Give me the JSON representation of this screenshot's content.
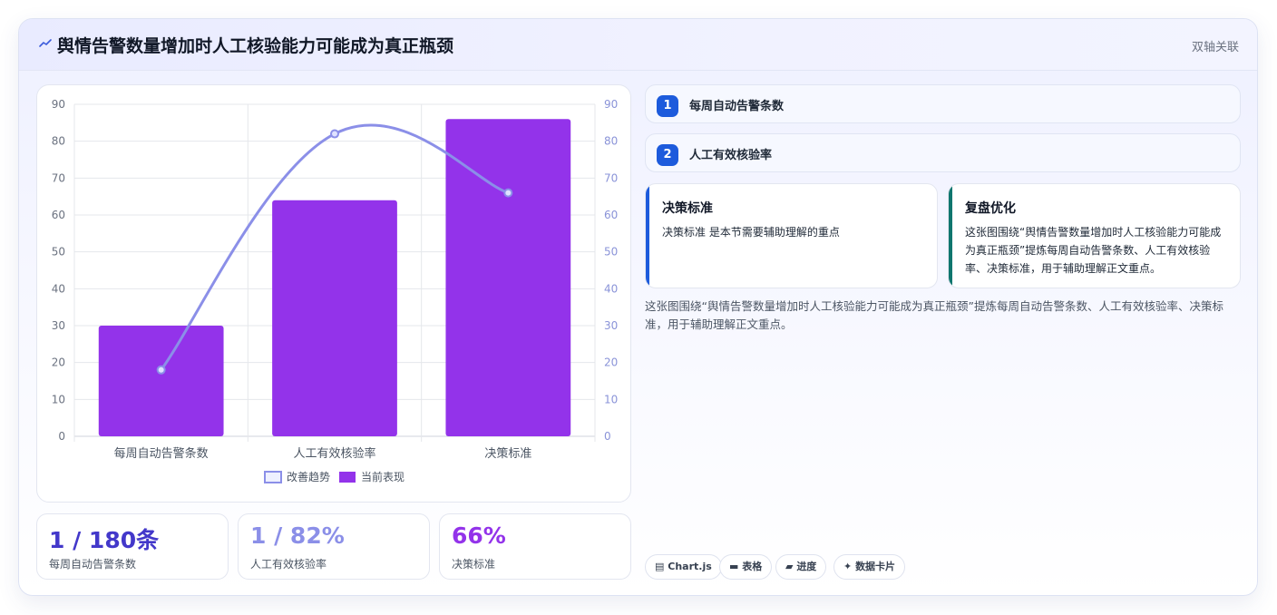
{
  "header": {
    "icon": "trend-line-icon",
    "title": "舆情告警数量增加时人工核验能力可能成为真正瓶颈",
    "tag": "双轴关联"
  },
  "chart_data": {
    "type": "bar",
    "categories": [
      "每周自动告警条数",
      "人工有效核验率",
      "决策标准"
    ],
    "series": [
      {
        "name": "当前表现",
        "kind": "bar",
        "axis": "left",
        "color": "#9333ea",
        "values": [
          30,
          64,
          86
        ]
      },
      {
        "name": "改善趋势",
        "kind": "line",
        "axis": "right",
        "color": "#8b8fe8",
        "values": [
          18,
          82,
          66
        ]
      }
    ],
    "ylim": [
      0,
      90
    ],
    "y2lim": [
      0,
      90
    ],
    "yticks": [
      0,
      10,
      20,
      30,
      40,
      50,
      60,
      70,
      80,
      90
    ],
    "legend_order": [
      "改善趋势",
      "当前表现"
    ],
    "legend_position": "bottom",
    "grid": true
  },
  "stats": [
    {
      "value": "1 / 180条",
      "label": "每周自动告警条数",
      "color": "#4338ca"
    },
    {
      "value": "1 / 82%",
      "label": "人工有效核验率",
      "color": "#8b8fe8"
    },
    {
      "value": "66%",
      "label": "决策标准",
      "color": "#9333ea"
    }
  ],
  "steps": [
    {
      "num": "1",
      "label": "每周自动告警条数"
    },
    {
      "num": "2",
      "label": "人工有效核验率"
    }
  ],
  "notes": [
    {
      "title": "决策标准",
      "body": "决策标准 是本节需要辅助理解的重点",
      "accent": "#1d5bdc"
    },
    {
      "title": "复盘优化",
      "body": "这张图围绕“舆情告警数量增加时人工核验能力可能成为真正瓶颈”提炼每周自动告警条数、人工有效核验率、决策标准，用于辅助理解正文重点。",
      "accent": "#0f766e"
    }
  ],
  "summary": "这张图围绕“舆情告警数量增加时人工核验能力可能成为真正瓶颈”提炼每周自动告警条数、人工有效核验率、决策标准，用于辅助理解正文重点。",
  "pills": [
    {
      "icon": "chart-icon",
      "glyph": "▤",
      "label": "Chart.js"
    },
    {
      "icon": "table-icon",
      "glyph": "▬",
      "label": "表格"
    },
    {
      "icon": "progress-icon",
      "glyph": "▰",
      "label": "进度"
    },
    {
      "icon": "sparkle-icon",
      "glyph": "✦",
      "label": "数据卡片"
    }
  ]
}
